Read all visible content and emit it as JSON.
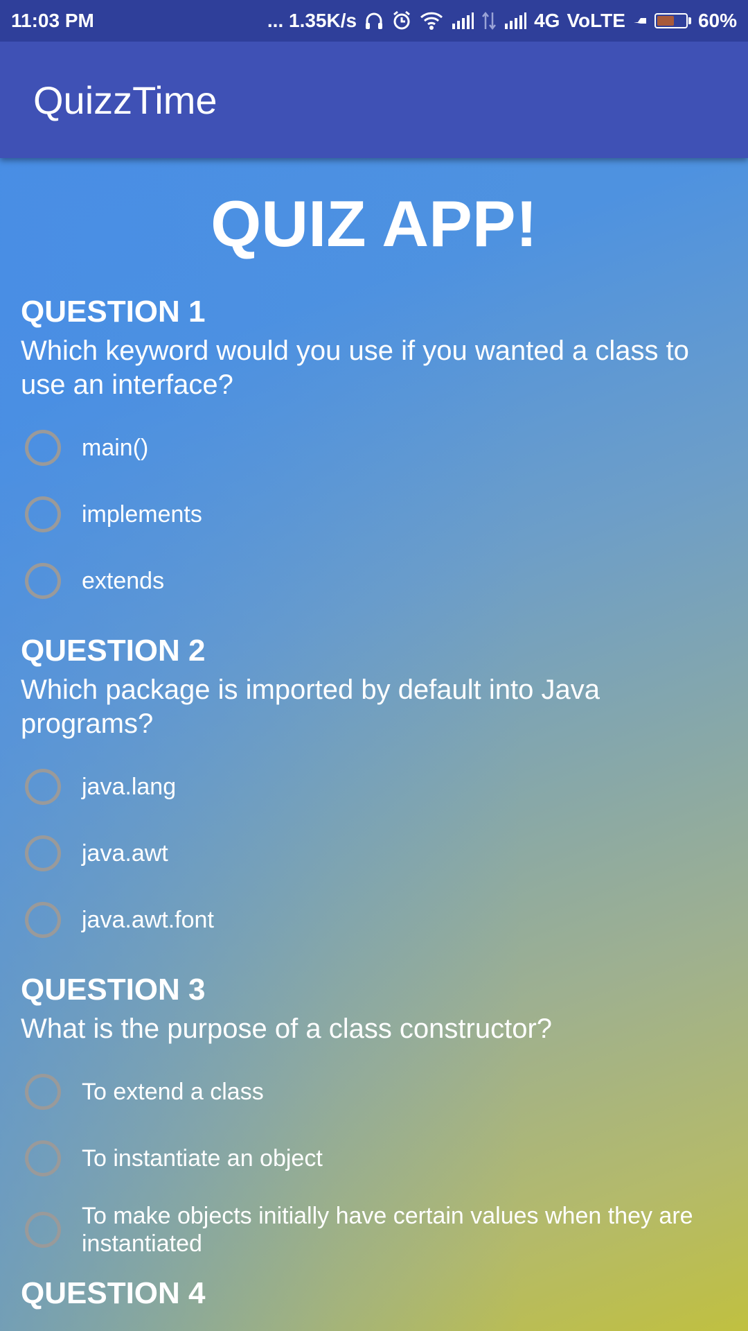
{
  "status_bar": {
    "time": "11:03 PM",
    "speed": "... 1.35K/s",
    "network": "4G",
    "volte": "VoLTE",
    "battery_percent": "60%",
    "battery_level": 0.6,
    "icons": [
      "headset-icon",
      "alarm-icon",
      "wifi-icon",
      "signal-icon",
      "data-arrows-icon",
      "signal-icon",
      "battery-icon"
    ]
  },
  "app_bar": {
    "title": "QuizzTime"
  },
  "main": {
    "heading": "QUIZ APP!",
    "questions": [
      {
        "label": "QUESTION 1",
        "text": "Which keyword would you use if you wanted a class to use an interface?",
        "options": [
          "main()",
          "implements",
          "extends"
        ]
      },
      {
        "label": "QUESTION 2",
        "text": "Which package is imported by default into Java programs?",
        "options": [
          "java.lang",
          "java.awt",
          "java.awt.font"
        ]
      },
      {
        "label": "QUESTION 3",
        "text": "What is the purpose of a class constructor?",
        "options": [
          "To extend a class",
          "To instantiate an object",
          "To make objects initially have certain values when they are instantiated"
        ]
      },
      {
        "label": "QUESTION 4"
      }
    ]
  },
  "colors": {
    "status_bar": "#2f3f9a",
    "app_bar": "#3f51b5",
    "radio_border": "#9a9a9a",
    "text": "#ffffff"
  }
}
